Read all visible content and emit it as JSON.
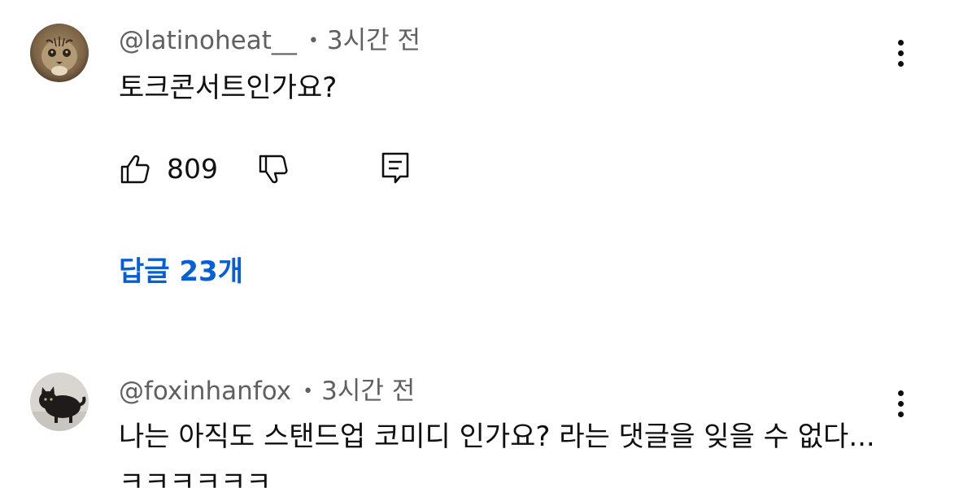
{
  "comments": [
    {
      "author": "@latinoheat__",
      "separator": "•",
      "time": "3시간 전",
      "text": "토크콘서트인가요?",
      "likes": "809",
      "replies_label": "답글 23개",
      "avatar_icon": "leopard-cat-avatar"
    },
    {
      "author": "@foxinhanfox",
      "separator": "•",
      "time": "3시간 전",
      "text": "나는 아직도 스탠드업 코미디 인가요? 라는 댓글을 잊을 수 없다... ㅋㅋㅋㅋㅋㅋ",
      "avatar_icon": "black-cat-avatar"
    }
  ],
  "colors": {
    "link": "#065fd4",
    "meta": "#606060",
    "text": "#0f0f0f"
  }
}
